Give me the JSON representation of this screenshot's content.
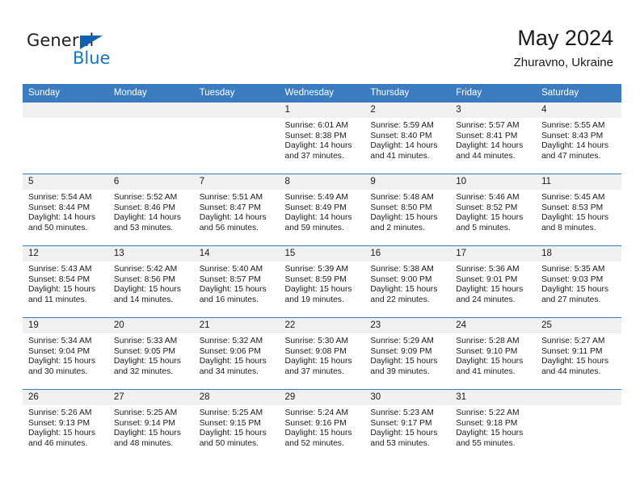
{
  "brand": {
    "name_top": "General",
    "name_bottom": "Blue",
    "triangle_color": "#1263ad",
    "blue_color": "#1b75bb"
  },
  "header": {
    "title": "May 2024",
    "location": "Zhuravno, Ukraine"
  },
  "theme": {
    "header_blue": "#3a7cbf",
    "daynum_bg": "#f0f0f0",
    "text": "#1a1a1a"
  },
  "labels": {
    "sunrise_prefix": "Sunrise:",
    "sunset_prefix": "Sunset:",
    "daylight_prefix": "Daylight:"
  },
  "weekdays": [
    "Sunday",
    "Monday",
    "Tuesday",
    "Wednesday",
    "Thursday",
    "Friday",
    "Saturday"
  ],
  "weeks": [
    [
      {
        "day": "",
        "empty": true
      },
      {
        "day": "",
        "empty": true
      },
      {
        "day": "",
        "empty": true
      },
      {
        "day": "1",
        "sunrise": "Sunrise: 6:01 AM",
        "sunset": "Sunset: 8:38 PM",
        "daylight1": "Daylight: 14 hours",
        "daylight2": "and 37 minutes."
      },
      {
        "day": "2",
        "sunrise": "Sunrise: 5:59 AM",
        "sunset": "Sunset: 8:40 PM",
        "daylight1": "Daylight: 14 hours",
        "daylight2": "and 41 minutes."
      },
      {
        "day": "3",
        "sunrise": "Sunrise: 5:57 AM",
        "sunset": "Sunset: 8:41 PM",
        "daylight1": "Daylight: 14 hours",
        "daylight2": "and 44 minutes."
      },
      {
        "day": "4",
        "sunrise": "Sunrise: 5:55 AM",
        "sunset": "Sunset: 8:43 PM",
        "daylight1": "Daylight: 14 hours",
        "daylight2": "and 47 minutes."
      }
    ],
    [
      {
        "day": "5",
        "sunrise": "Sunrise: 5:54 AM",
        "sunset": "Sunset: 8:44 PM",
        "daylight1": "Daylight: 14 hours",
        "daylight2": "and 50 minutes."
      },
      {
        "day": "6",
        "sunrise": "Sunrise: 5:52 AM",
        "sunset": "Sunset: 8:46 PM",
        "daylight1": "Daylight: 14 hours",
        "daylight2": "and 53 minutes."
      },
      {
        "day": "7",
        "sunrise": "Sunrise: 5:51 AM",
        "sunset": "Sunset: 8:47 PM",
        "daylight1": "Daylight: 14 hours",
        "daylight2": "and 56 minutes."
      },
      {
        "day": "8",
        "sunrise": "Sunrise: 5:49 AM",
        "sunset": "Sunset: 8:49 PM",
        "daylight1": "Daylight: 14 hours",
        "daylight2": "and 59 minutes."
      },
      {
        "day": "9",
        "sunrise": "Sunrise: 5:48 AM",
        "sunset": "Sunset: 8:50 PM",
        "daylight1": "Daylight: 15 hours",
        "daylight2": "and 2 minutes."
      },
      {
        "day": "10",
        "sunrise": "Sunrise: 5:46 AM",
        "sunset": "Sunset: 8:52 PM",
        "daylight1": "Daylight: 15 hours",
        "daylight2": "and 5 minutes."
      },
      {
        "day": "11",
        "sunrise": "Sunrise: 5:45 AM",
        "sunset": "Sunset: 8:53 PM",
        "daylight1": "Daylight: 15 hours",
        "daylight2": "and 8 minutes."
      }
    ],
    [
      {
        "day": "12",
        "sunrise": "Sunrise: 5:43 AM",
        "sunset": "Sunset: 8:54 PM",
        "daylight1": "Daylight: 15 hours",
        "daylight2": "and 11 minutes."
      },
      {
        "day": "13",
        "sunrise": "Sunrise: 5:42 AM",
        "sunset": "Sunset: 8:56 PM",
        "daylight1": "Daylight: 15 hours",
        "daylight2": "and 14 minutes."
      },
      {
        "day": "14",
        "sunrise": "Sunrise: 5:40 AM",
        "sunset": "Sunset: 8:57 PM",
        "daylight1": "Daylight: 15 hours",
        "daylight2": "and 16 minutes."
      },
      {
        "day": "15",
        "sunrise": "Sunrise: 5:39 AM",
        "sunset": "Sunset: 8:59 PM",
        "daylight1": "Daylight: 15 hours",
        "daylight2": "and 19 minutes."
      },
      {
        "day": "16",
        "sunrise": "Sunrise: 5:38 AM",
        "sunset": "Sunset: 9:00 PM",
        "daylight1": "Daylight: 15 hours",
        "daylight2": "and 22 minutes."
      },
      {
        "day": "17",
        "sunrise": "Sunrise: 5:36 AM",
        "sunset": "Sunset: 9:01 PM",
        "daylight1": "Daylight: 15 hours",
        "daylight2": "and 24 minutes."
      },
      {
        "day": "18",
        "sunrise": "Sunrise: 5:35 AM",
        "sunset": "Sunset: 9:03 PM",
        "daylight1": "Daylight: 15 hours",
        "daylight2": "and 27 minutes."
      }
    ],
    [
      {
        "day": "19",
        "sunrise": "Sunrise: 5:34 AM",
        "sunset": "Sunset: 9:04 PM",
        "daylight1": "Daylight: 15 hours",
        "daylight2": "and 30 minutes."
      },
      {
        "day": "20",
        "sunrise": "Sunrise: 5:33 AM",
        "sunset": "Sunset: 9:05 PM",
        "daylight1": "Daylight: 15 hours",
        "daylight2": "and 32 minutes."
      },
      {
        "day": "21",
        "sunrise": "Sunrise: 5:32 AM",
        "sunset": "Sunset: 9:06 PM",
        "daylight1": "Daylight: 15 hours",
        "daylight2": "and 34 minutes."
      },
      {
        "day": "22",
        "sunrise": "Sunrise: 5:30 AM",
        "sunset": "Sunset: 9:08 PM",
        "daylight1": "Daylight: 15 hours",
        "daylight2": "and 37 minutes."
      },
      {
        "day": "23",
        "sunrise": "Sunrise: 5:29 AM",
        "sunset": "Sunset: 9:09 PM",
        "daylight1": "Daylight: 15 hours",
        "daylight2": "and 39 minutes."
      },
      {
        "day": "24",
        "sunrise": "Sunrise: 5:28 AM",
        "sunset": "Sunset: 9:10 PM",
        "daylight1": "Daylight: 15 hours",
        "daylight2": "and 41 minutes."
      },
      {
        "day": "25",
        "sunrise": "Sunrise: 5:27 AM",
        "sunset": "Sunset: 9:11 PM",
        "daylight1": "Daylight: 15 hours",
        "daylight2": "and 44 minutes."
      }
    ],
    [
      {
        "day": "26",
        "sunrise": "Sunrise: 5:26 AM",
        "sunset": "Sunset: 9:13 PM",
        "daylight1": "Daylight: 15 hours",
        "daylight2": "and 46 minutes."
      },
      {
        "day": "27",
        "sunrise": "Sunrise: 5:25 AM",
        "sunset": "Sunset: 9:14 PM",
        "daylight1": "Daylight: 15 hours",
        "daylight2": "and 48 minutes."
      },
      {
        "day": "28",
        "sunrise": "Sunrise: 5:25 AM",
        "sunset": "Sunset: 9:15 PM",
        "daylight1": "Daylight: 15 hours",
        "daylight2": "and 50 minutes."
      },
      {
        "day": "29",
        "sunrise": "Sunrise: 5:24 AM",
        "sunset": "Sunset: 9:16 PM",
        "daylight1": "Daylight: 15 hours",
        "daylight2": "and 52 minutes."
      },
      {
        "day": "30",
        "sunrise": "Sunrise: 5:23 AM",
        "sunset": "Sunset: 9:17 PM",
        "daylight1": "Daylight: 15 hours",
        "daylight2": "and 53 minutes."
      },
      {
        "day": "31",
        "sunrise": "Sunrise: 5:22 AM",
        "sunset": "Sunset: 9:18 PM",
        "daylight1": "Daylight: 15 hours",
        "daylight2": "and 55 minutes."
      },
      {
        "day": "",
        "empty": true
      }
    ]
  ]
}
